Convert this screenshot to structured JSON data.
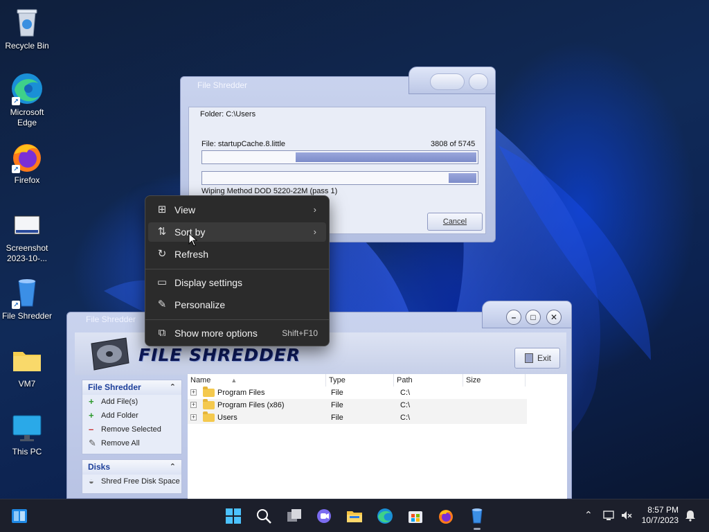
{
  "desktop": {
    "icons": [
      {
        "label": "Recycle Bin",
        "icon": "recycle-bin-icon"
      },
      {
        "label": "Microsoft Edge",
        "icon": "edge-icon"
      },
      {
        "label": "Firefox",
        "icon": "firefox-icon"
      },
      {
        "label": "Screenshot 2023-10-...",
        "icon": "image-file-icon"
      },
      {
        "label": "File Shredder",
        "icon": "shredder-bin-icon"
      },
      {
        "label": "VM7",
        "icon": "folder-icon"
      },
      {
        "label": "This PC",
        "icon": "monitor-icon"
      }
    ]
  },
  "progress_dialog": {
    "title": "File Shredder",
    "folder_text": "Folder: C:\\Users",
    "file_text": "File: startupCache.8.little",
    "file_count": "3808  of  5745",
    "file_progress": 0.66,
    "pass_progress": 0.1,
    "method_text": "Wiping Method DOD 5220-22M  (pass 1)",
    "cancel_label": "Cancel"
  },
  "main_window": {
    "title": "File Shredder",
    "logo_text": "FILE SHREDDER",
    "exit_label": "Exit",
    "panel_shredder": {
      "header": "File Shredder",
      "items": [
        "Add File(s)",
        "Add Folder",
        "Remove Selected",
        "Remove All"
      ]
    },
    "panel_disks": {
      "header": "Disks",
      "items": [
        "Shred Free Disk Space"
      ]
    },
    "columns": [
      "Name",
      "Type",
      "Path",
      "Size"
    ],
    "rows": [
      {
        "name": "Program Files",
        "type": "File",
        "path": "C:\\",
        "size": ""
      },
      {
        "name": "Program Files (x86)",
        "type": "File",
        "path": "C:\\",
        "size": ""
      },
      {
        "name": "Users",
        "type": "File",
        "path": "C:\\",
        "size": ""
      }
    ]
  },
  "context_menu": {
    "items": [
      {
        "label": "View",
        "icon": "grid-icon"
      },
      {
        "label": "Sort by",
        "icon": "sort-icon"
      },
      {
        "label": "Refresh",
        "icon": "refresh-icon"
      },
      {
        "label": "Display settings",
        "icon": "display-icon"
      },
      {
        "label": "Personalize",
        "icon": "pen-icon"
      },
      {
        "label": "Show more options",
        "icon": "expand-icon",
        "shortcut": "Shift+F10"
      }
    ]
  },
  "taskbar": {
    "time": "8:57 PM",
    "date": "10/7/2023"
  },
  "colors": {
    "menu_bg": "#2b2b2b",
    "window_frame": "#c9d3ee",
    "progress_fill": "#8b99d3",
    "taskbar_bg": "#1c1f2b"
  }
}
